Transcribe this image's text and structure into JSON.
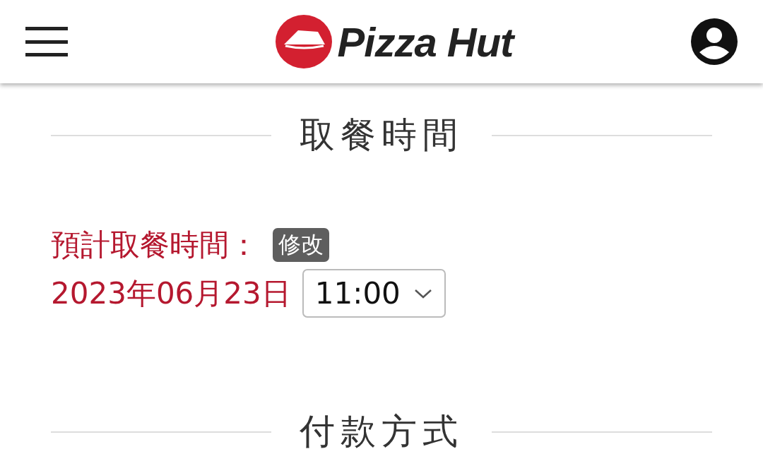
{
  "header": {
    "brand": "Pizza Hut"
  },
  "pickup_section": {
    "title": "取餐時間",
    "label": "預計取餐時間：",
    "edit_button": "修改",
    "date": "2023年06月23日",
    "time_select": {
      "value": "11:00"
    }
  },
  "payment_section": {
    "title": "付款方式"
  }
}
